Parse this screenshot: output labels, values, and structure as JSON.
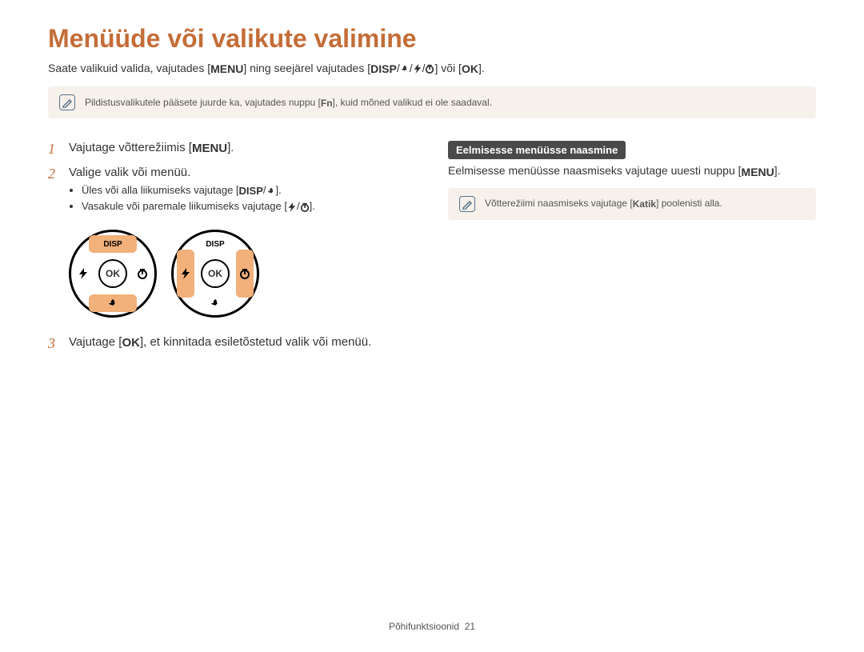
{
  "title": "Menüüde või valikute valimine",
  "intro": {
    "pre": "Saate valikuid valida, vajutades [",
    "menu": "MENU",
    "mid": "] ning seejärel vajutades [",
    "disp": "DISP",
    "post_navkeys": "] või [",
    "ok": "OK",
    "end": "]."
  },
  "note1": {
    "pre": "Pildistusvalikutele pääsete juurde ka, vajutades nuppu [",
    "fn": "Fn",
    "post": "], kuid mõned valikud ei ole saadaval."
  },
  "left": {
    "step1": {
      "pre": "Vajutage võtterežiimis [",
      "menu": "MENU",
      "post": "]."
    },
    "step2": {
      "text": "Valige valik või menüü.",
      "bullet1": {
        "pre": "Üles või alla liikumiseks vajutage [",
        "disp": "DISP",
        "post": "]."
      },
      "bullet2": {
        "pre": "Vasakule või paremale liikumiseks vajutage [",
        "post": "]."
      }
    },
    "step3": {
      "pre": "Vajutage [",
      "ok": "OK",
      "post": "], et kinnitada esiletõstetud valik või menüü."
    },
    "dial_disp": "DISP",
    "dial_ok": "OK"
  },
  "right": {
    "subhead": "Eelmisesse menüüsse naasmine",
    "line": {
      "pre": "Eelmisesse menüüsse naasmiseks vajutage uuesti nuppu [",
      "menu": "MENU",
      "post": "]."
    },
    "note": {
      "pre": "Võtterežiimi naasmiseks vajutage [",
      "shutter": "Katik",
      "post": "] poolenisti alla."
    }
  },
  "footer": {
    "label": "Põhifunktsioonid",
    "page": "21"
  }
}
